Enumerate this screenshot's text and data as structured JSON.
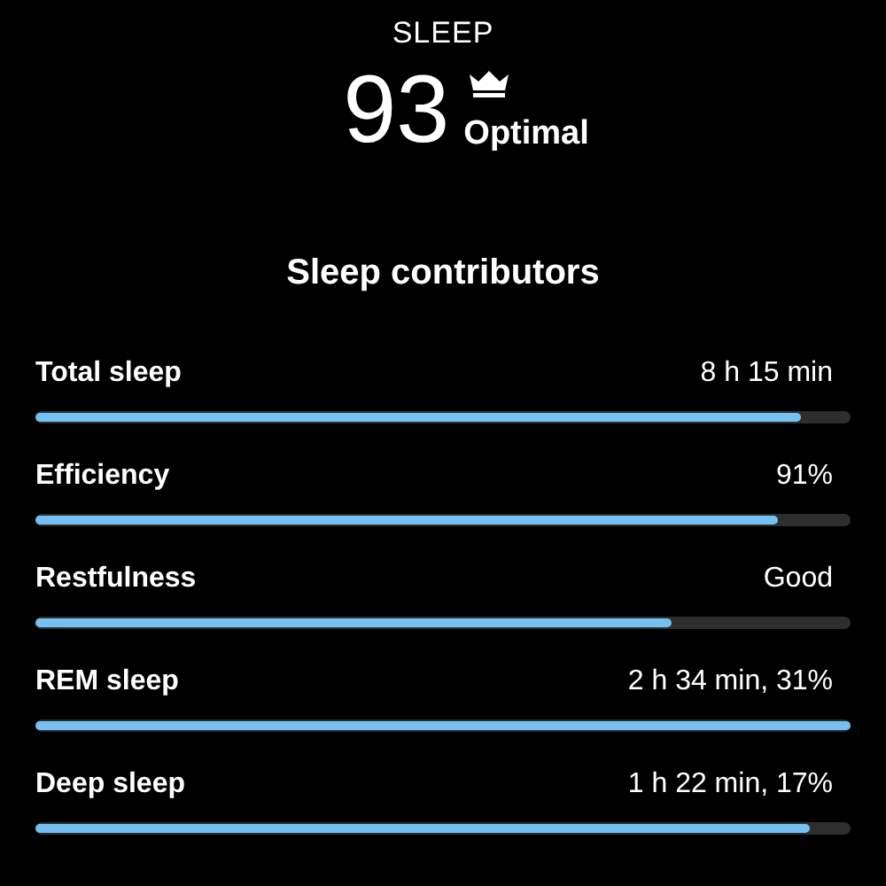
{
  "title": "SLEEP",
  "score": {
    "value": "93",
    "rating": "Optimal"
  },
  "section_title": "Sleep contributors",
  "contributors": [
    {
      "name": "Total sleep",
      "reading": "8 h 15 min",
      "level": 0.94
    },
    {
      "name": "Efficiency",
      "reading": "91%",
      "level": 0.91
    },
    {
      "name": "Restfulness",
      "reading": "Good",
      "level": 0.78
    },
    {
      "name": "REM sleep",
      "reading": "2 h 34 min, 31%",
      "level": 1.0
    },
    {
      "name": "Deep sleep",
      "reading": "1 h 22 min, 17%",
      "level": 0.95
    }
  ]
}
